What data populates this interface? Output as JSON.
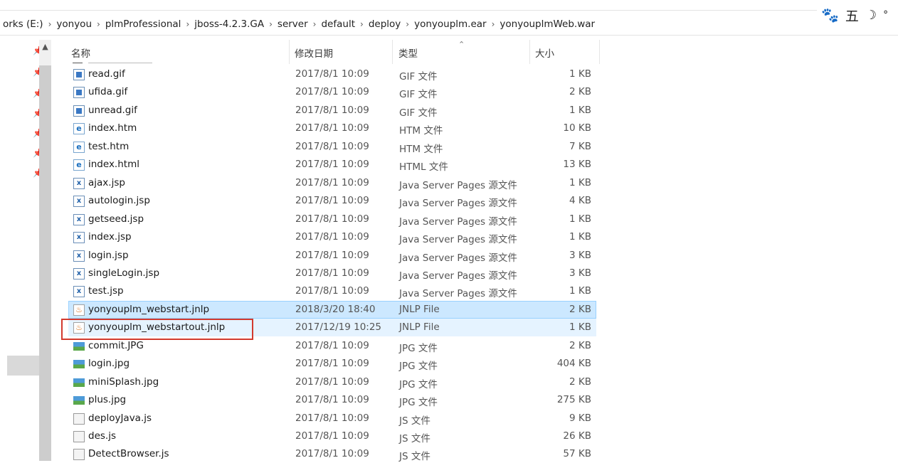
{
  "breadcrumb": [
    "orks (E:)",
    "yonyou",
    "plmProfessional",
    "jboss-4.2.3.GA",
    "server",
    "default",
    "deploy",
    "yonyouplm.ear",
    "yonyouplmWeb.war"
  ],
  "ime": {
    "mode_text": "五"
  },
  "columns": {
    "name": "名称",
    "date": "修改日期",
    "type": "类型",
    "size": "大小"
  },
  "files": [
    {
      "name": "read.gif",
      "date": "2017/8/1 10:09",
      "type": "GIF 文件",
      "size": "1 KB",
      "icon": "gif-file-icon"
    },
    {
      "name": "ufida.gif",
      "date": "2017/8/1 10:09",
      "type": "GIF 文件",
      "size": "2 KB",
      "icon": "gif-file-icon"
    },
    {
      "name": "unread.gif",
      "date": "2017/8/1 10:09",
      "type": "GIF 文件",
      "size": "1 KB",
      "icon": "gif-file-icon"
    },
    {
      "name": "index.htm",
      "date": "2017/8/1 10:09",
      "type": "HTM 文件",
      "size": "10 KB",
      "icon": "html-file-icon"
    },
    {
      "name": "test.htm",
      "date": "2017/8/1 10:09",
      "type": "HTM 文件",
      "size": "7 KB",
      "icon": "html-file-icon"
    },
    {
      "name": "index.html",
      "date": "2017/8/1 10:09",
      "type": "HTML 文件",
      "size": "13 KB",
      "icon": "html-file-icon"
    },
    {
      "name": "ajax.jsp",
      "date": "2017/8/1 10:09",
      "type": "Java Server Pages 源文件",
      "size": "1 KB",
      "icon": "jsp-file-icon"
    },
    {
      "name": "autologin.jsp",
      "date": "2017/8/1 10:09",
      "type": "Java Server Pages 源文件",
      "size": "4 KB",
      "icon": "jsp-file-icon"
    },
    {
      "name": "getseed.jsp",
      "date": "2017/8/1 10:09",
      "type": "Java Server Pages 源文件",
      "size": "1 KB",
      "icon": "jsp-file-icon"
    },
    {
      "name": "index.jsp",
      "date": "2017/8/1 10:09",
      "type": "Java Server Pages 源文件",
      "size": "1 KB",
      "icon": "jsp-file-icon"
    },
    {
      "name": "login.jsp",
      "date": "2017/8/1 10:09",
      "type": "Java Server Pages 源文件",
      "size": "3 KB",
      "icon": "jsp-file-icon"
    },
    {
      "name": "singleLogin.jsp",
      "date": "2017/8/1 10:09",
      "type": "Java Server Pages 源文件",
      "size": "3 KB",
      "icon": "jsp-file-icon"
    },
    {
      "name": "test.jsp",
      "date": "2017/8/1 10:09",
      "type": "Java Server Pages 源文件",
      "size": "1 KB",
      "icon": "jsp-file-icon"
    },
    {
      "name": "yonyouplm_webstart.jnlp",
      "date": "2018/3/20 18:40",
      "type": "JNLP File",
      "size": "2 KB",
      "icon": "java-jnlp-icon",
      "state": "selected"
    },
    {
      "name": "yonyouplm_webstartout.jnlp",
      "date": "2017/12/19 10:25",
      "type": "JNLP File",
      "size": "1 KB",
      "icon": "java-jnlp-icon",
      "state": "hover",
      "annotated": true
    },
    {
      "name": "commit.JPG",
      "date": "2017/8/1 10:09",
      "type": "JPG 文件",
      "size": "2 KB",
      "icon": "jpg-file-icon"
    },
    {
      "name": "login.jpg",
      "date": "2017/8/1 10:09",
      "type": "JPG 文件",
      "size": "404 KB",
      "icon": "jpg-file-icon"
    },
    {
      "name": "miniSplash.jpg",
      "date": "2017/8/1 10:09",
      "type": "JPG 文件",
      "size": "2 KB",
      "icon": "jpg-file-icon"
    },
    {
      "name": "plus.jpg",
      "date": "2017/8/1 10:09",
      "type": "JPG 文件",
      "size": "275 KB",
      "icon": "jpg-file-icon"
    },
    {
      "name": "deployJava.js",
      "date": "2017/8/1 10:09",
      "type": "JS 文件",
      "size": "9 KB",
      "icon": "js-file-icon"
    },
    {
      "name": "des.js",
      "date": "2017/8/1 10:09",
      "type": "JS 文件",
      "size": "26 KB",
      "icon": "js-file-icon"
    },
    {
      "name": "DetectBrowser.js",
      "date": "2017/8/1 10:09",
      "type": "JS 文件",
      "size": "57 KB",
      "icon": "js-file-icon"
    }
  ],
  "colors": {
    "selected_bg": "#cce8ff",
    "hover_bg": "#e5f3ff",
    "annotation_border": "#d23a2e"
  }
}
